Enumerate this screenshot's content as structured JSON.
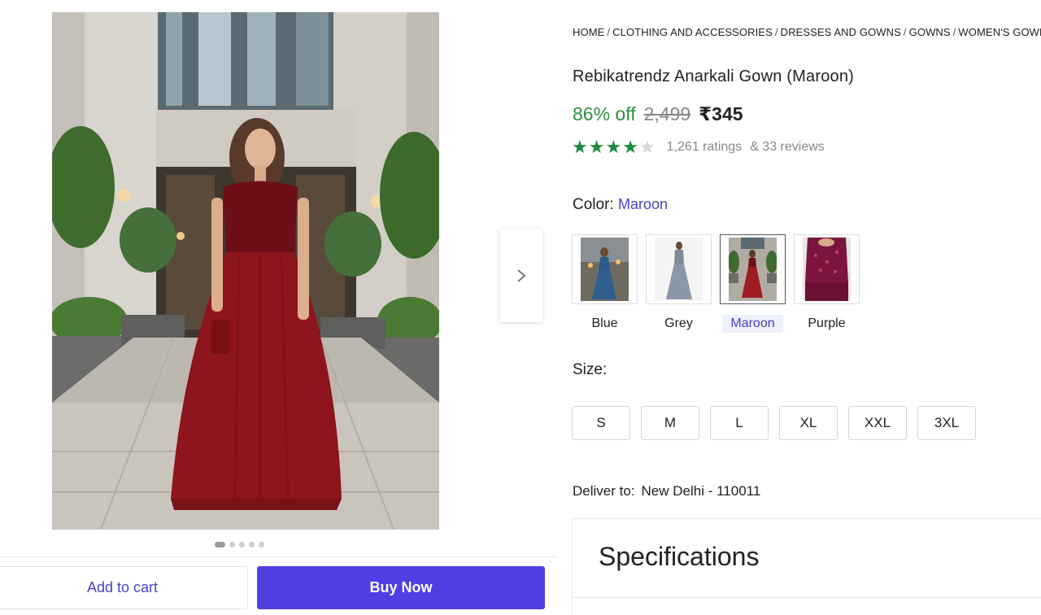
{
  "breadcrumb": [
    {
      "label": "HOME"
    },
    {
      "label": "CLOTHING AND ACCESSORIES"
    },
    {
      "label": "DRESSES AND GOWNS"
    },
    {
      "label": "GOWNS"
    },
    {
      "label": "WOMEN'S GOWNS"
    }
  ],
  "product": {
    "title": "Rebikatrendz Anarkali Gown (Maroon)",
    "discount": "86% off",
    "mrp": "2,499",
    "price": "₹345",
    "rating": 4,
    "max_rating": 5,
    "ratings_text": "1,261 ratings",
    "reviews_text": "& 33 reviews"
  },
  "color": {
    "label": "Color:",
    "selected": "Maroon",
    "options": [
      {
        "label": "Blue",
        "hex": "#2f5f8f"
      },
      {
        "label": "Grey",
        "hex": "#8a97a8"
      },
      {
        "label": "Maroon",
        "hex": "#9e1b22"
      },
      {
        "label": "Purple",
        "hex": "#7b1540"
      }
    ]
  },
  "size": {
    "label": "Size:",
    "options": [
      "S",
      "M",
      "L",
      "XL",
      "XXL",
      "3XL"
    ]
  },
  "delivery": {
    "label": "Deliver to:",
    "location": "New Delhi - 110011"
  },
  "specifications": {
    "title": "Specifications"
  },
  "actions": {
    "add_to_cart": "Add to cart",
    "buy_now": "Buy Now"
  },
  "gallery": {
    "image_count": 5,
    "active_index": 0
  },
  "colors": {
    "accent": "#4f3fe3",
    "discount": "#2f8f3f",
    "star": "#1b8a3a"
  }
}
